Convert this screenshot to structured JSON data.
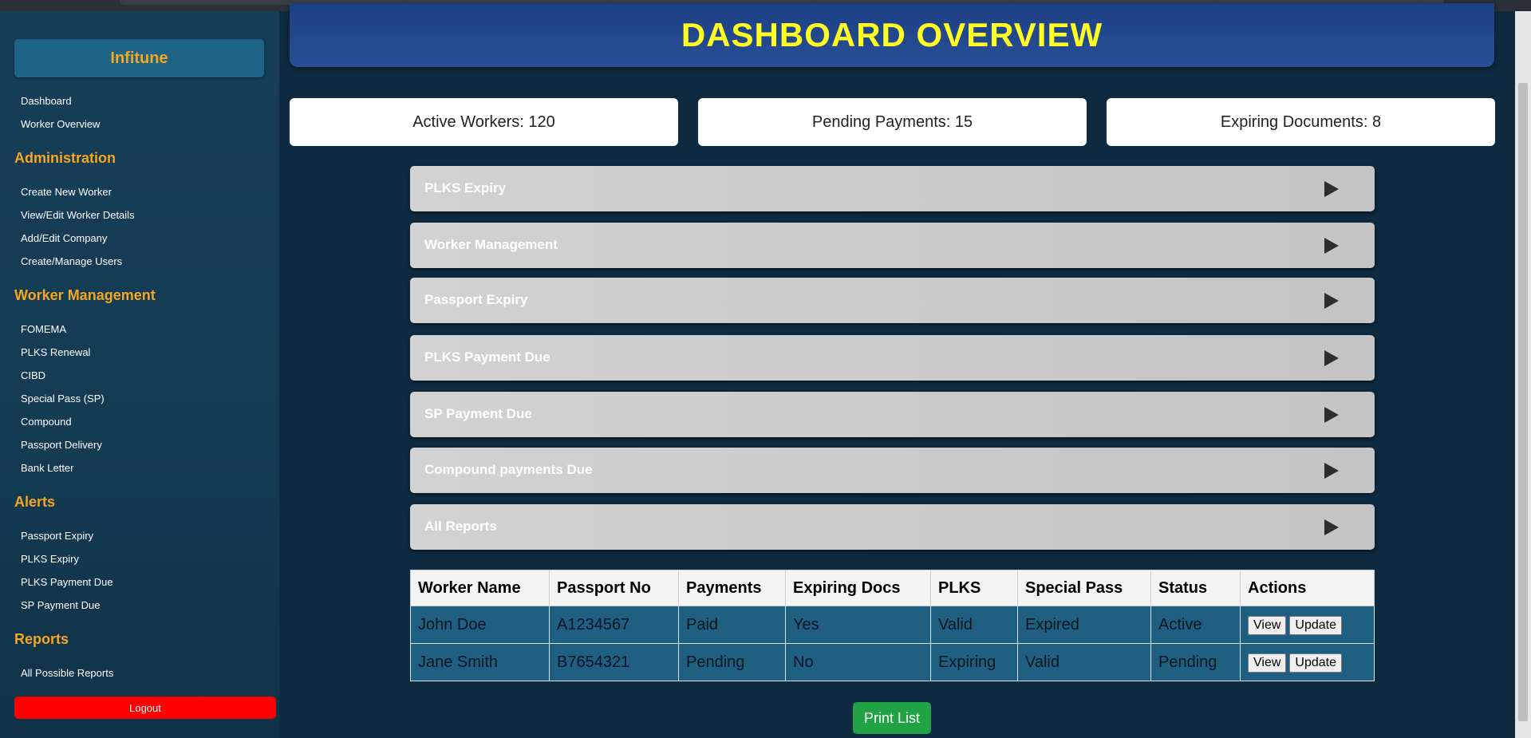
{
  "header": {
    "title": "DASHBOARD OVERVIEW"
  },
  "sidebar": {
    "brand": "Infitune",
    "top_items": [
      "Dashboard",
      "Worker Overview"
    ],
    "sections": [
      {
        "title": "Administration",
        "items": [
          "Create New Worker",
          "View/Edit Worker Details",
          "Add/Edit Company",
          "Create/Manage Users"
        ]
      },
      {
        "title": "Worker Management",
        "items": [
          "FOMEMA",
          "PLKS Renewal",
          "CIBD",
          "Special Pass (SP)",
          "Compound",
          "Passport Delivery",
          "Bank Letter"
        ]
      },
      {
        "title": "Alerts",
        "items": [
          "Passport Expiry",
          "PLKS Expiry",
          "PLKS Payment Due",
          "SP Payment Due"
        ]
      },
      {
        "title": "Reports",
        "items": [
          "All Possible Reports"
        ]
      }
    ],
    "logout": "Logout"
  },
  "stats": [
    "Active Workers: 120",
    "Pending Payments: 15",
    "Expiring Documents: 8"
  ],
  "accordions": [
    "PLKS Expiry",
    "Worker Management",
    "Passport Expiry",
    "PLKS Payment Due",
    "SP Payment Due",
    "Compound payments Due",
    "All Reports"
  ],
  "table": {
    "headers": [
      "Worker Name",
      "Passport No",
      "Payments",
      "Expiring Docs",
      "PLKS",
      "Special Pass",
      "Status",
      "Actions"
    ],
    "rows": [
      [
        "John Doe",
        "A1234567",
        "Paid",
        "Yes",
        "Valid",
        "Expired",
        "Active"
      ],
      [
        "Jane Smith",
        "B7654321",
        "Pending",
        "No",
        "Expiring",
        "Valid",
        "Pending"
      ]
    ],
    "view_label": "View",
    "update_label": "Update"
  },
  "print_label": "Print List",
  "colors": {
    "accent": "#f5a623",
    "title": "#ffff22",
    "logout": "#ff0000",
    "print": "#21a345",
    "row_bg": "#1e5f82"
  }
}
